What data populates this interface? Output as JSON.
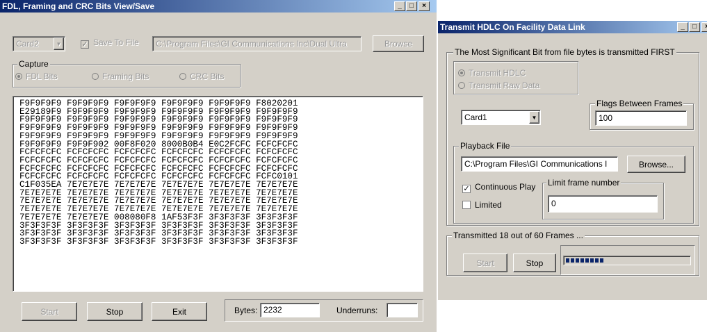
{
  "fdl_window": {
    "title": "FDL, Framing and CRC Bits View/Save",
    "card": "Card2",
    "save_to_file_label": "Save To File",
    "save_to_file_checked": true,
    "path": "C:\\Program Files\\GI Communications Inc\\Dual Ultra",
    "browse_label": "Browse",
    "capture_label": "Capture",
    "capture_options": [
      "FDL Bits",
      "Framing Bits",
      "CRC Bits"
    ],
    "capture_selected": "FDL Bits",
    "hex_rows": [
      "F9F9F9F9 F9F9F9F9 F9F9F9F9 F9F9F9F9 F9F9F9F9 F8020201",
      "E29189F9 F9F9F9F9 F9F9F9F9 F9F9F9F9 F9F9F9F9 F9F9F9F9",
      "F9F9F9F9 F9F9F9F9 F9F9F9F9 F9F9F9F9 F9F9F9F9 F9F9F9F9",
      "F9F9F9F9 F9F9F9F9 F9F9F9F9 F9F9F9F9 F9F9F9F9 F9F9F9F9",
      "F9F9F9F9 F9F9F9F9 F9F9F9F9 F9F9F9F9 F9F9F9F9 F9F9F9F9",
      "F9F9F9F9 F9F9F902 00F8F020 8000B0B4 E0C2FCFC FCFCFCFC",
      "FCFCFCFC FCFCFCFC FCFCFCFC FCFCFCFC FCFCFCFC FCFCFCFC",
      "FCFCFCFC FCFCFCFC FCFCFCFC FCFCFCFC FCFCFCFC FCFCFCFC",
      "FCFCFCFC FCFCFCFC FCFCFCFC FCFCFCFC FCFCFCFC FCFCFCFC",
      "FCFCFCFC FCFCFCFC FCFCFCFC FCFCFCFC FCFCFCFC FCFC0101",
      "C1F035EA 7E7E7E7E 7E7E7E7E 7E7E7E7E 7E7E7E7E 7E7E7E7E",
      "7E7E7E7E 7E7E7E7E 7E7E7E7E 7E7E7E7E 7E7E7E7E 7E7E7E7E",
      "7E7E7E7E 7E7E7E7E 7E7E7E7E 7E7E7E7E 7E7E7E7E 7E7E7E7E",
      "7E7E7E7E 7E7E7E7E 7E7E7E7E 7E7E7E7E 7E7E7E7E 7E7E7E7E",
      "7E7E7E7E 7E7E7E7E 008080F8 1AF53F3F 3F3F3F3F 3F3F3F3F",
      "3F3F3F3F 3F3F3F3F 3F3F3F3F 3F3F3F3F 3F3F3F3F 3F3F3F3F",
      "3F3F3F3F 3F3F3F3F 3F3F3F3F 3F3F3F3F 3F3F3F3F 3F3F3F3F",
      "3F3F3F3F 3F3F3F3F 3F3F3F3F 3F3F3F3F 3F3F3F3F 3F3F3F3F"
    ],
    "start_label": "Start",
    "stop_label": "Stop",
    "exit_label": "Exit",
    "bytes_label": "Bytes:",
    "bytes_value": "2232",
    "underruns_label": "Underruns:",
    "underruns_value": ""
  },
  "hdlc_window": {
    "title": "Transmit HDLC On Facility Data Link",
    "msb_group_label": "The Most Significant Bit from file bytes is transmitted FIRST",
    "transmit_options": [
      "Transmit HDLC",
      "Transmit Raw Data"
    ],
    "transmit_selected": "Transmit HDLC",
    "card": "Card1",
    "flags_label": "Flags Between Frames",
    "flags_value": "100",
    "playback_label": "Playback File",
    "playback_path": "C:\\Program Files\\GI Communications I",
    "browse_label": "Browse...",
    "continuous_label": "Continuous Play",
    "continuous_checked": true,
    "limited_label": "Limited",
    "limited_checked": false,
    "limit_frame_label": "Limit frame number",
    "limit_frame_value": "0",
    "status_label": "Transmitted 18 out of 60 Frames ...",
    "progress_fraction": 0.3,
    "start_label": "Start",
    "stop_label": "Stop"
  },
  "colors": {
    "titlebar_start": "#0a246a",
    "titlebar_end": "#a6caf0",
    "face": "#d4d0c8",
    "progress": "#0a246a"
  },
  "icons": [
    "minimize-icon",
    "maximize-icon",
    "close-icon",
    "dropdown-arrow-icon",
    "checkmark-icon"
  ]
}
